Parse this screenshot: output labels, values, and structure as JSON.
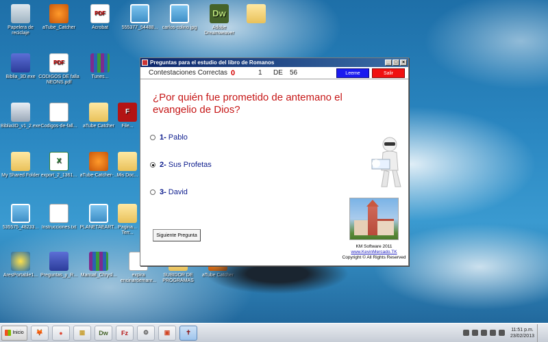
{
  "desktop": {
    "icons": [
      {
        "label": "Papelera de reciclaje",
        "icon": "recycle-bin-icon"
      },
      {
        "label": "aTube_Catcher",
        "icon": "vlc-icon"
      },
      {
        "label": "Acrobat",
        "icon": "pdf-icon"
      },
      {
        "label": "555377_54488...",
        "icon": "image-file-icon"
      },
      {
        "label": "carlos-colino.jpg",
        "icon": "image-file-icon"
      },
      {
        "label": "Adobe Dreamweaver",
        "icon": "dreamweaver-icon"
      },
      {
        "label": "",
        "icon": "folder-icon"
      },
      {
        "label": "Biblia_3D.exe",
        "icon": "installer-icon"
      },
      {
        "label": "CODIGOS DE falla NEONS.pdf",
        "icon": "pdf-icon"
      },
      {
        "label": "Tunes...",
        "icon": "winrar-icon"
      },
      {
        "label": "Biblia3D_v1_2.exe",
        "icon": "installer-icon"
      },
      {
        "label": "Codigos-de-fall...",
        "icon": "document-icon"
      },
      {
        "label": "aTube Catcher",
        "icon": "folder-icon"
      },
      {
        "label": "File...",
        "icon": "flashget-icon"
      },
      {
        "label": "My Shared Folder",
        "icon": "folder-icon"
      },
      {
        "label": "export_2_1361...",
        "icon": "excel-icon"
      },
      {
        "label": "aTube-Catcher-...",
        "icon": "vlc-icon"
      },
      {
        "label": "Mis Doc...",
        "icon": "folder-icon"
      },
      {
        "label": "535575_48233...",
        "icon": "image-file-icon"
      },
      {
        "label": "Instrucciones.txt",
        "icon": "text-file-icon"
      },
      {
        "label": "PLANETAEART...",
        "icon": "image-file-icon"
      },
      {
        "label": "Pagina... Terr...",
        "icon": "folder-icon"
      },
      {
        "label": "AresPortable1...",
        "icon": "ares-icon"
      },
      {
        "label": "Preguntas_y_R...",
        "icon": "installer-icon"
      },
      {
        "label": "Manual_Chrysl...",
        "icon": "winrar-icon"
      },
      {
        "label": "expira encinardemanr...",
        "icon": "text-file-icon"
      },
      {
        "label": "SUBIDOR DE PROGRAMAS",
        "icon": "folder-icon"
      },
      {
        "label": "aTube Catcher",
        "icon": "vlc-icon"
      }
    ]
  },
  "window": {
    "title": "Preguntas para el estudio del libro de Romanos",
    "minimize": "_",
    "maximize": "□",
    "close": "×",
    "score": {
      "label": "Contestaciones Correctas",
      "value": "0",
      "current": "1",
      "of_label": "DE",
      "total": "56"
    },
    "buttons": {
      "read": "Leeme",
      "exit": "Salir",
      "next": "Siguiente Pregunta"
    },
    "question": "¿Por quién fue prometido de antemano el evangelio de Dios?",
    "options": [
      {
        "number": "1-",
        "text": "Pablo",
        "selected": false
      },
      {
        "number": "2-",
        "text": "Sus Profetas",
        "selected": true
      },
      {
        "number": "3-",
        "text": "David",
        "selected": false
      }
    ],
    "credits": {
      "company": "KM Software 2011",
      "website": "www.KevinMercado.TK",
      "copyright": "Copyright © All Rights Reserved"
    }
  },
  "taskbar": {
    "start_label": "Inicio",
    "items": [
      {
        "icon": "firefox-icon",
        "glyph": "🦊"
      },
      {
        "icon": "chrome-icon",
        "glyph": "●"
      },
      {
        "icon": "explorer-folder-icon",
        "glyph": "▦"
      },
      {
        "icon": "dreamweaver-icon",
        "glyph": "Dw"
      },
      {
        "icon": "filezilla-icon",
        "glyph": "Fz"
      },
      {
        "icon": "tools-icon",
        "glyph": "⚙"
      },
      {
        "icon": "presentation-icon",
        "glyph": "▣"
      },
      {
        "icon": "bible-app-icon",
        "glyph": "✝"
      }
    ],
    "clock_time": "11:51 p.m.",
    "clock_date": "23/02/2013"
  }
}
